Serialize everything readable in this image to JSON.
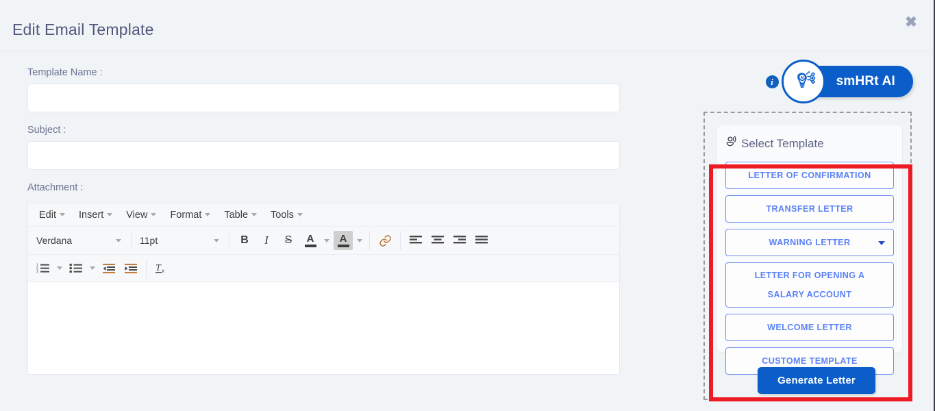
{
  "modal": {
    "title": "Edit Email Template",
    "close_icon": "close-icon"
  },
  "form": {
    "template_name_label": "Template Name :",
    "template_name_value": "",
    "template_name_placeholder": "",
    "subject_label": "Subject :",
    "subject_value": "",
    "subject_placeholder": "",
    "attachment_label": "Attachment :"
  },
  "editor": {
    "menubar": [
      {
        "label": "Edit"
      },
      {
        "label": "Insert"
      },
      {
        "label": "View"
      },
      {
        "label": "Format"
      },
      {
        "label": "Table"
      },
      {
        "label": "Tools"
      }
    ],
    "font_family": "Verdana",
    "font_size": "11pt",
    "buttons": {
      "bold": "B",
      "italic": "I",
      "strikethrough": "S",
      "text_color": "A",
      "background_color": "A",
      "link": "link-icon",
      "align_left": "align-left-icon",
      "align_center": "align-center-icon",
      "align_right": "align-right-icon",
      "align_justify": "align-justify-icon",
      "numbered_list": "numbered-list-icon",
      "bullet_list": "bullet-list-icon",
      "decrease_indent": "decrease-indent-icon",
      "increase_indent": "increase-indent-icon",
      "clear_formatting": "clear-formatting-icon"
    },
    "content": ""
  },
  "ai": {
    "info_icon_label": "i",
    "badge_icon": "ai-lightbulb-icon",
    "pill_label": "smHRt AI"
  },
  "template_panel": {
    "title": "Select Template",
    "title_icon": "announcement-icon",
    "options": [
      {
        "label": "LETTER OF CONFIRMATION",
        "has_dropdown": false,
        "two_line": false
      },
      {
        "label": "TRANSFER LETTER",
        "has_dropdown": false,
        "two_line": false
      },
      {
        "label": "WARNING LETTER",
        "has_dropdown": true,
        "two_line": false
      },
      {
        "label": "LETTER FOR OPENING A SALARY ACCOUNT",
        "has_dropdown": false,
        "two_line": true
      },
      {
        "label": "WELCOME LETTER",
        "has_dropdown": false,
        "two_line": false
      },
      {
        "label": "CUSTOME TEMPLATE",
        "has_dropdown": false,
        "two_line": false
      }
    ],
    "generate_label": "Generate Letter"
  },
  "colors": {
    "accent_blue": "#0b5ec9",
    "template_button_blue": "#5b82f7",
    "highlight_red": "#ed1c24",
    "page_background": "#f1f4f6",
    "title_text": "#51567d"
  }
}
